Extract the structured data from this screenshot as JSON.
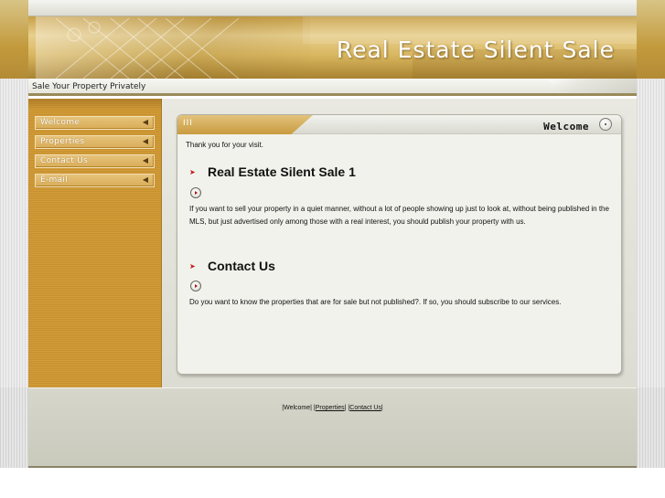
{
  "header": {
    "site_title": "Real Estate Silent Sale",
    "tagline": "Sale Your Property Privately"
  },
  "sidebar": {
    "items": [
      {
        "label": "Welcome",
        "arrow_icon": "left-arrow-icon"
      },
      {
        "label": "Properties",
        "arrow_icon": "left-arrow-icon"
      },
      {
        "label": "Contact Us",
        "arrow_icon": "left-arrow-icon"
      },
      {
        "label": "E-mail",
        "arrow_icon": "left-arrow-icon"
      }
    ]
  },
  "panel": {
    "tab_mark": "III",
    "title": "Welcome",
    "intro": "Thank you for your visit.",
    "sections": [
      {
        "title": "Real Estate Silent Sale 1",
        "body": "If you want to sell your property in a quiet manner, without a lot of people showing up just to look at, without being published in the MLS, but just advertised only among those with a real interest, you should publish your property with us."
      },
      {
        "title": "Contact Us",
        "body": "Do you want to know the properties that are for sale but not published?. If so, you should subscribe to our services."
      }
    ]
  },
  "footer": {
    "links": [
      "Welcome",
      "Properties",
      "Contact Us"
    ],
    "separator": "|"
  },
  "colors": {
    "accent_gold": "#c99b3f",
    "bullet_red": "#c01818",
    "panel_bg": "#f2f2ec"
  }
}
